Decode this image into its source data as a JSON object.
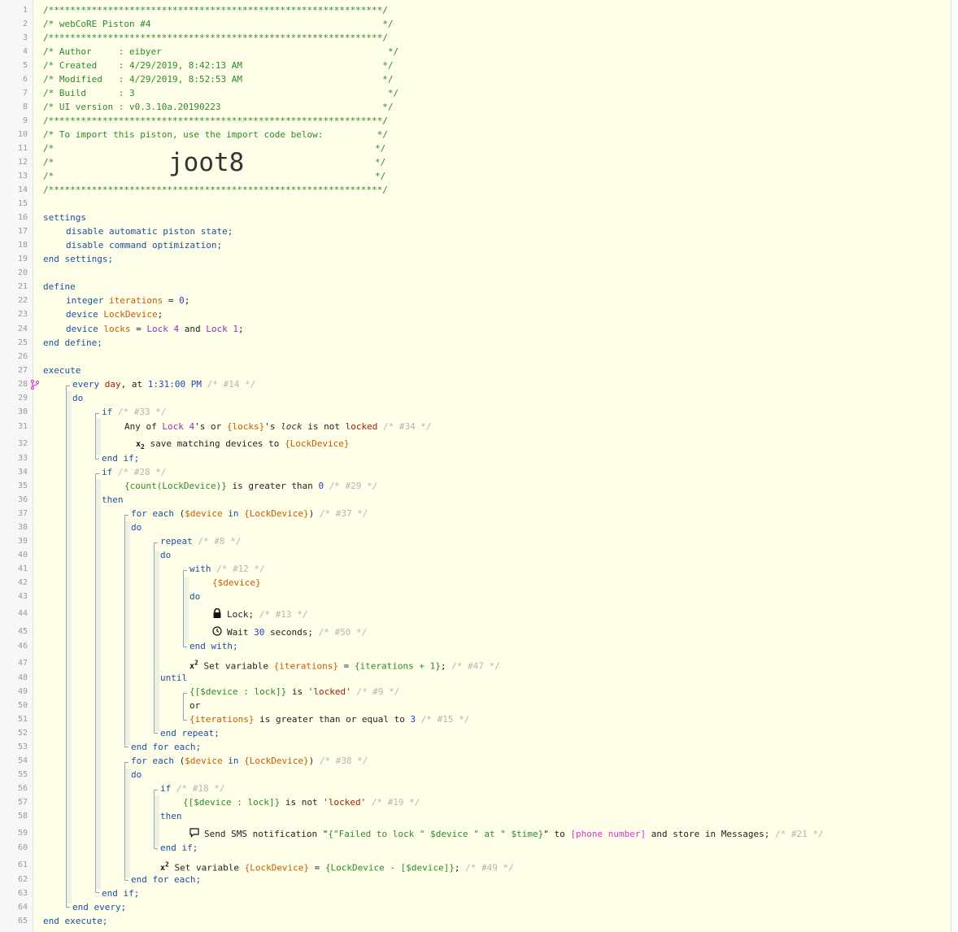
{
  "editor": {
    "line_count": 65,
    "header": {
      "border": "/**************************************************************/",
      "title": "/* webCoRE Piston #4                                           */",
      "author": "/* Author     : eibyer                                          */",
      "created": "/* Created    : 4/29/2019, 8:42:13 AM                          */",
      "modified": "/* Modified   : 4/29/2019, 8:52:53 AM                          */",
      "build": "/* Build      : 3                                               */",
      "ui_version": "/* UI version : v0.3.10a.20190223                              */",
      "import_note": "/* To import this piston, use the import code below:          */",
      "empty_open": "/*",
      "empty_close": "*/",
      "import_code": "joot8"
    },
    "settings": {
      "open": "settings",
      "line1": [
        "disable",
        "automatic",
        "piston",
        "state;"
      ],
      "line2": [
        "disable",
        "command",
        "optimization;"
      ],
      "close": "end settings;"
    },
    "define": {
      "open": "define",
      "l22_type": "integer",
      "l22_name": "iterations",
      "l22_rest": " = ",
      "l22_val": "0",
      "l22_end": ";",
      "l23_type": "device",
      "l23_name": "LockDevice",
      "l23_end": ";",
      "l24_type": "device",
      "l24_name": "locks",
      "l24_eq": " = ",
      "l24_dev1": "Lock 4",
      "l24_and": " and ",
      "l24_dev2": "Lock 1",
      "l24_end": ";",
      "close": "end define;"
    },
    "execute": {
      "open": "execute",
      "l28_every": "every",
      "l28_day": "day",
      "l28_at": ", at ",
      "l28_time": "1:31:00 PM",
      "l28_cmt": "/* #14 */",
      "l29": "do",
      "l30_if": "if",
      "l30_cmt": "/* #33 */",
      "l31_any": "Any of ",
      "l31_dev": "Lock 4",
      "l31_s": "'s or ",
      "l31_var": "{locks}",
      "l31_s2": "'s ",
      "l31_attr": "lock",
      "l31_isnot": " is not ",
      "l31_val": "locked",
      "l31_cmt": "/* #34 */",
      "l32_text": "save matching devices to ",
      "l32_var": "{LockDevice}",
      "l33": "end if;",
      "l34_if": "if",
      "l34_cmt": "/* #28 */",
      "l35_expr": "{count(LockDevice)}",
      "l35_mid": " is greater than ",
      "l35_num": "0",
      "l35_cmt": "/* #29 */",
      "l36": "then",
      "l37_for": "for each",
      "l37_par": " (",
      "l37_var": "$device",
      "l37_in": " in ",
      "l37_var2": "{LockDevice}",
      "l37_close": ")",
      "l37_cmt": "/* #37 */",
      "l38": "do",
      "l39_repeat": "repeat",
      "l39_cmt": "/* #8 */",
      "l40": "do",
      "l41_with": "with",
      "l41_cmt": "/* #12 */",
      "l42_var": "{$device}",
      "l43": "do",
      "l44_cmd": "Lock;",
      "l44_cmt": "/* #13 */",
      "l45_cmd": "Wait ",
      "l45_num": "30",
      "l45_rest": " seconds;",
      "l45_cmt": "/* #50 */",
      "l46": "end with;",
      "l47_cmd": "Set variable ",
      "l47_var": "{iterations}",
      "l47_eq": " = ",
      "l47_expr": "{iterations + 1}",
      "l47_end": ";",
      "l47_cmt": "/* #47 */",
      "l48": "until",
      "l49_expr": "{[$device : lock]}",
      "l49_is": " is ",
      "l49_str": "'locked'",
      "l49_cmt": "/* #9 */",
      "l50": "or",
      "l51_var": "{iterations}",
      "l51_mid": " is greater than or equal to ",
      "l51_num": "3",
      "l51_cmt": "/* #15 */",
      "l52": "end repeat;",
      "l53": "end for each;",
      "l54_for": "for each",
      "l54_par": " (",
      "l54_var": "$device",
      "l54_in": " in ",
      "l54_var2": "{LockDevice}",
      "l54_close": ")",
      "l54_cmt": "/* #38 */",
      "l55": "do",
      "l56_if": "if",
      "l56_cmt": "/* #18 */",
      "l57_expr": "{[$device : lock]}",
      "l57_isnot": " is not ",
      "l57_str": "'locked'",
      "l57_cmt": "/* #19 */",
      "l58": "then",
      "l59_cmd": "Send SMS notification \"",
      "l59_expr": "{\"Failed to lock \" $device \" at \" $time}",
      "l59_q": "\" to ",
      "l59_phone": "[phone number]",
      "l59_rest": " and store in Messages;",
      "l59_cmt": "/* #21 */",
      "l60": "end if;",
      "l61_cmd": "Set variable ",
      "l61_var": "{LockDevice}",
      "l61_eq": " = ",
      "l61_expr": "{LockDevice - [$device]}",
      "l61_end": ";",
      "l61_cmt": "/* #49 */",
      "l62": "end for each;",
      "l63": "end if;",
      "l64": "end every;",
      "close": "end execute;"
    },
    "icons": [
      "lock-icon",
      "clock-icon",
      "message-icon",
      "subscript-x2-icon",
      "superscript-x2-icon",
      "branch-icon"
    ],
    "colors": {
      "background": "#ffffe9",
      "keyword": "#1a4fa0",
      "device": "#8f30c0",
      "variable": "#c85a00",
      "expression": "#2a8a2a",
      "comment": "#b3b3b3",
      "value": "#a0200d",
      "number": "#1f44c4",
      "highlight": "#d92fd9"
    }
  }
}
